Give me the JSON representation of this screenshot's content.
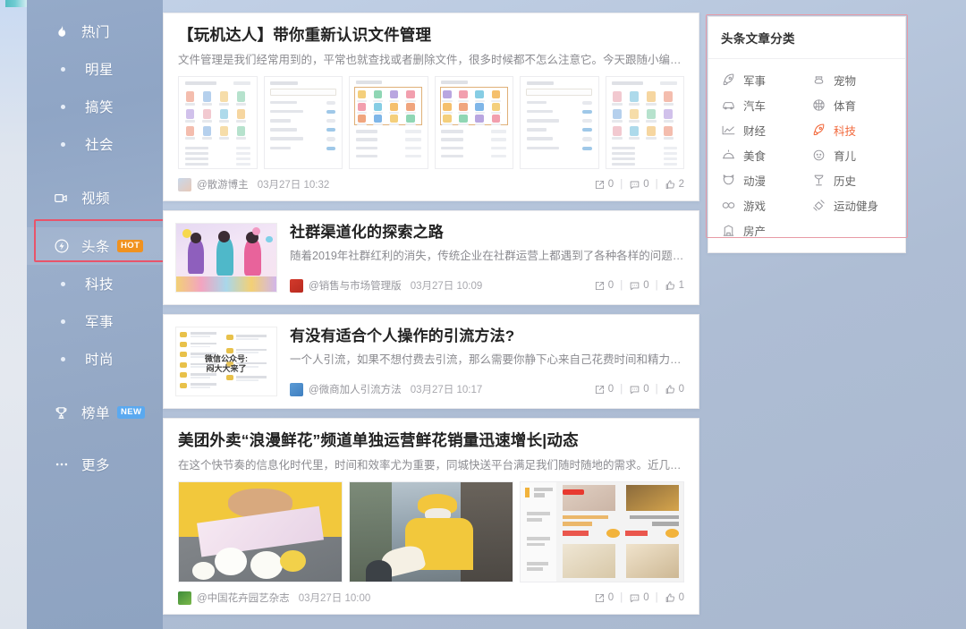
{
  "sidebar": {
    "items": [
      {
        "label": "热门",
        "icon": "flame-icon",
        "type": "main",
        "badge": null
      },
      {
        "label": "明星",
        "icon": "dot",
        "type": "sub",
        "badge": null
      },
      {
        "label": "搞笑",
        "icon": "dot",
        "type": "sub",
        "badge": null
      },
      {
        "label": "社会",
        "icon": "dot",
        "type": "sub",
        "badge": null
      },
      {
        "label": "视频",
        "icon": "video-camera-icon",
        "type": "main",
        "badge": null
      },
      {
        "label": "头条",
        "icon": "lightning-bolt-icon",
        "type": "main",
        "badge": "HOT",
        "badge_color": "#f0921f",
        "active": true
      },
      {
        "label": "科技",
        "icon": "dot",
        "type": "sub",
        "badge": null
      },
      {
        "label": "军事",
        "icon": "dot",
        "type": "sub",
        "badge": null
      },
      {
        "label": "时尚",
        "icon": "dot",
        "type": "sub",
        "badge": null
      },
      {
        "label": "榜单",
        "icon": "trophy-icon",
        "type": "main",
        "badge": "NEW",
        "badge_color": "#5aa9f0"
      },
      {
        "label": "更多",
        "icon": "ellipsis-icon",
        "type": "main",
        "badge": null
      }
    ]
  },
  "feed": {
    "cards": [
      {
        "layout": "gallery",
        "title": "【玩机达人】带你重新认识文件管理",
        "desc": "文件管理是我们经常用到的，平常也就查找或者删除文件，很多时候都不怎么注意它。今天跟随小编去...",
        "author": "@散游博主",
        "date": "03月27日 10:32",
        "shares": "0",
        "comments": "0",
        "likes": "2",
        "thumb_count": 6
      },
      {
        "layout": "horizontal",
        "title": "社群渠道化的探索之路",
        "desc": "随着2019年社群红利的消失，传统企业在社群运营上都遇到了各种各样的问题。...",
        "author": "@销售与市场管理版",
        "date": "03月27日 10:09",
        "shares": "0",
        "comments": "0",
        "likes": "1"
      },
      {
        "layout": "horizontal",
        "title": "有没有适合个人操作的引流方法?",
        "desc": "一个人引流，如果不想付费去引流，那么需要你静下心来自己花费时间和精力来引...",
        "author": "@微商加人引流方法",
        "date": "03月27日 10:17",
        "shares": "0",
        "comments": "0",
        "likes": "0"
      },
      {
        "layout": "gallery",
        "title": "美团外卖“浪漫鲜花”频道单独运营鲜花销量迅速增长|动态",
        "desc": "在这个快节奏的信息化时代里，时间和效率尤为重要，同城快送平台满足我们随时随地的需求。近几年...",
        "author": "@中国花卉园艺杂志",
        "date": "03月27日 10:00",
        "shares": "0",
        "comments": "0",
        "likes": "0",
        "thumb_count": 3
      }
    ]
  },
  "categories_panel": {
    "title": "头条文章分类",
    "items": [
      {
        "label": "军事",
        "icon": "rocket-icon",
        "highlighted": false
      },
      {
        "label": "宠物",
        "icon": "paw-icon",
        "highlighted": false
      },
      {
        "label": "汽车",
        "icon": "car-icon",
        "highlighted": false
      },
      {
        "label": "体育",
        "icon": "basketball-icon",
        "highlighted": false
      },
      {
        "label": "财经",
        "icon": "line-chart-icon",
        "highlighted": false
      },
      {
        "label": "科技",
        "icon": "rocket-icon",
        "highlighted": true
      },
      {
        "label": "美食",
        "icon": "food-dome-icon",
        "highlighted": false
      },
      {
        "label": "育儿",
        "icon": "baby-face-icon",
        "highlighted": false
      },
      {
        "label": "动漫",
        "icon": "cat-face-icon",
        "highlighted": false
      },
      {
        "label": "历史",
        "icon": "hourglass-icon",
        "highlighted": false
      },
      {
        "label": "游戏",
        "icon": "gamepad-icon",
        "highlighted": false
      },
      {
        "label": "运动健身",
        "icon": "dumbbell-icon",
        "highlighted": false
      },
      {
        "label": "房产",
        "icon": "building-icon",
        "highlighted": false
      }
    ]
  },
  "colors": {
    "accent_orange": "#f2693c",
    "hot_badge": "#f0921f",
    "new_badge": "#5aa9f0",
    "annotation_red": "#e8546a",
    "sidebar_text": "#ffffff"
  }
}
